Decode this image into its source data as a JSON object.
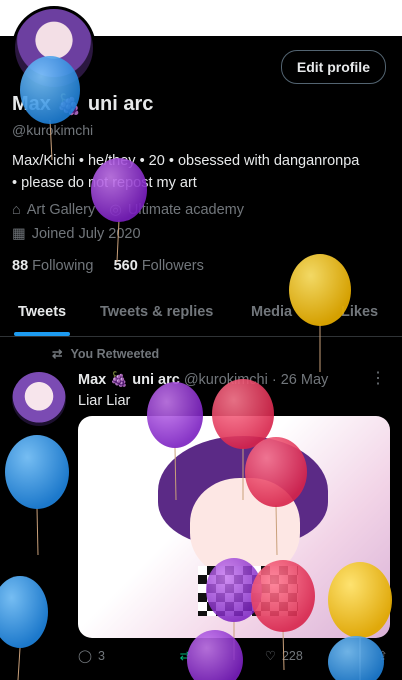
{
  "profile": {
    "name": "Max",
    "name_suffix": "uni arc",
    "handle": "@kurokimchi",
    "edit_label": "Edit profile",
    "bio_line1": "Max/Kichi • he/they • 20 • obsessed with danganronpa",
    "bio_line2": "• please do not repost my art",
    "location": "Art Gallery",
    "website": "Ultimate academy",
    "joined": "Joined July 2020",
    "following_count": "88",
    "following_label": "Following",
    "followers_count": "560",
    "followers_label": "Followers"
  },
  "tabs": [
    "Tweets",
    "Tweets & replies",
    "Media",
    "Likes"
  ],
  "tweet": {
    "retweet_label": "You Retweeted",
    "author": "Max",
    "author_suffix": "uni arc",
    "handle_date": "@kurokimchi · 26 May",
    "text": "Liar Liar",
    "replies": "3",
    "likes": "228"
  },
  "colors": {
    "accent": "#1d9bf0",
    "retweet": "#00ba7c",
    "muted": "#71767b"
  }
}
